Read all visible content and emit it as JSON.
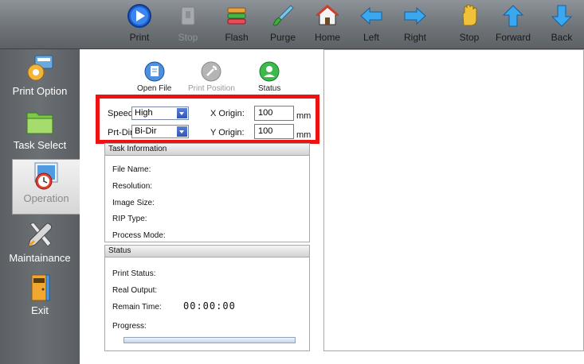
{
  "toolbar": {
    "buttons": [
      {
        "label": "Print",
        "icon": "play-circle-icon",
        "enabled": true
      },
      {
        "label": "Stop",
        "icon": "stop-box-icon",
        "enabled": false
      },
      {
        "label": "Flash",
        "icon": "flash-stack-icon",
        "enabled": true
      },
      {
        "label": "Purge",
        "icon": "purge-brush-icon",
        "enabled": true
      },
      {
        "label": "Home",
        "icon": "home-icon",
        "enabled": true
      },
      {
        "label": "Left",
        "icon": "arrow-left-icon",
        "enabled": true
      },
      {
        "label": "Right",
        "icon": "arrow-right-icon",
        "enabled": true
      },
      {
        "label": "Stop",
        "icon": "hand-stop-icon",
        "enabled": true
      },
      {
        "label": "Forward",
        "icon": "arrow-up-icon",
        "enabled": true
      },
      {
        "label": "Back",
        "icon": "arrow-down-icon",
        "enabled": true
      }
    ]
  },
  "sidebar": {
    "items": [
      {
        "label": "Print Option",
        "icon": "gear-printer-icon"
      },
      {
        "label": "Task Select",
        "icon": "folder-icon"
      },
      {
        "label": "Operation",
        "icon": "clock-photo-icon",
        "active": true
      },
      {
        "label": "Maintainance",
        "icon": "wrench-screwdriver-icon"
      },
      {
        "label": "Exit",
        "icon": "exit-door-icon"
      }
    ]
  },
  "subtoolbar": {
    "open_file": "Open File",
    "print_position": "Print Position",
    "status": "Status"
  },
  "settings": {
    "speed_label": "Speed:",
    "speed_value": "High",
    "prtdir_label": "Prt-Dir:",
    "prtdir_value": "Bi-Dir",
    "x_origin_label": "X Origin:",
    "x_origin_value": "100",
    "y_origin_label": "Y Origin:",
    "y_origin_value": "100",
    "unit": "mm"
  },
  "task_info": {
    "title": "Task Information",
    "file_name": "File Name:",
    "resolution": "Resolution:",
    "image_size": "Image Size:",
    "rip_type": "RIP Type:",
    "process_mode": "Process Mode:"
  },
  "status": {
    "title": "Status",
    "print_status": "Print Status:",
    "real_output": "Real Output:",
    "remain_time": "Remain Time:",
    "remain_time_value": "00:00:00",
    "progress": "Progress:",
    "progress_fraction": 0
  },
  "colors": {
    "highlight_border": "#ee1111",
    "toolbar_bg": "#6f7479",
    "sidebar_bg": "#62666b",
    "accent_blue": "#2f6fd6"
  }
}
